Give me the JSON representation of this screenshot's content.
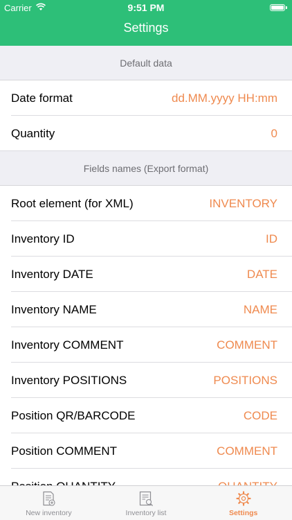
{
  "status_bar": {
    "carrier": "Carrier",
    "time": "9:51 PM"
  },
  "nav": {
    "title": "Settings"
  },
  "sections": [
    {
      "header": "Default data",
      "rows": [
        {
          "label": "Date format",
          "value": "dd.MM.yyyy HH:mm"
        },
        {
          "label": "Quantity",
          "value": "0"
        }
      ]
    },
    {
      "header": "Fields names (Export format)",
      "rows": [
        {
          "label": "Root element (for XML)",
          "value": "INVENTORY"
        },
        {
          "label": "Inventory ID",
          "value": "ID"
        },
        {
          "label": "Inventory DATE",
          "value": "DATE"
        },
        {
          "label": "Inventory NAME",
          "value": "NAME"
        },
        {
          "label": "Inventory COMMENT",
          "value": "COMMENT"
        },
        {
          "label": "Inventory POSITIONS",
          "value": "POSITIONS"
        },
        {
          "label": "Position QR/BARCODE",
          "value": "CODE"
        },
        {
          "label": "Position COMMENT",
          "value": "COMMENT"
        },
        {
          "label": "Position QUANTITY",
          "value": "QUANTITY"
        }
      ]
    }
  ],
  "tabbar": {
    "tabs": [
      {
        "label": "New inventory",
        "icon": "new-document-icon"
      },
      {
        "label": "Inventory list",
        "icon": "list-search-icon"
      },
      {
        "label": "Settings",
        "icon": "gear-icon"
      }
    ],
    "active_index": 2
  },
  "colors": {
    "brand": "#2dbf78",
    "accent": "#ef8a4f"
  }
}
